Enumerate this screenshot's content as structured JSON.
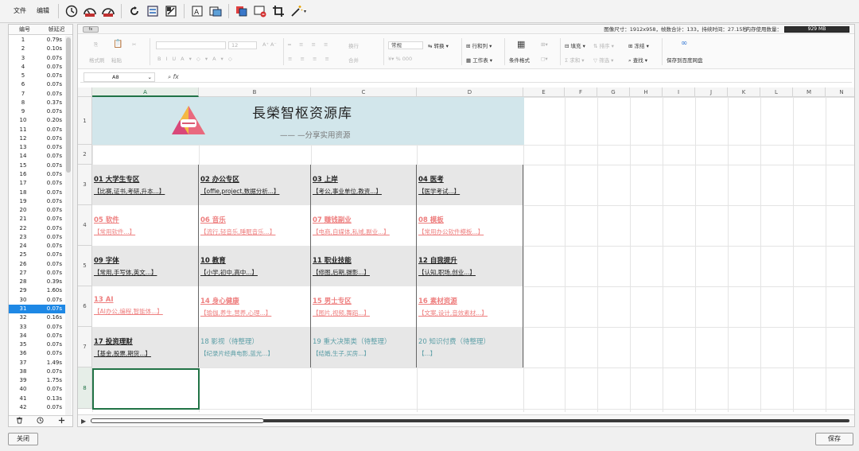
{
  "menu": {
    "file": "文件",
    "edit": "编辑"
  },
  "info": {
    "summary": "图像尺寸：1912x958，帧数合计：133，持续时间：27.15秒",
    "memory_label": "内存使用数量：",
    "memory_value": "929 MB",
    "fx_badge": "fx"
  },
  "frames": {
    "col_index": "编号",
    "col_delay": "帧延迟",
    "selected_index": 30,
    "items": [
      {
        "n": "1",
        "d": "0.79s"
      },
      {
        "n": "2",
        "d": "0.10s"
      },
      {
        "n": "3",
        "d": "0.07s"
      },
      {
        "n": "4",
        "d": "0.07s"
      },
      {
        "n": "5",
        "d": "0.07s"
      },
      {
        "n": "6",
        "d": "0.07s"
      },
      {
        "n": "7",
        "d": "0.07s"
      },
      {
        "n": "8",
        "d": "0.37s"
      },
      {
        "n": "9",
        "d": "0.07s"
      },
      {
        "n": "10",
        "d": "0.20s"
      },
      {
        "n": "11",
        "d": "0.07s"
      },
      {
        "n": "12",
        "d": "0.07s"
      },
      {
        "n": "13",
        "d": "0.07s"
      },
      {
        "n": "14",
        "d": "0.07s"
      },
      {
        "n": "15",
        "d": "0.07s"
      },
      {
        "n": "16",
        "d": "0.07s"
      },
      {
        "n": "17",
        "d": "0.07s"
      },
      {
        "n": "18",
        "d": "0.07s"
      },
      {
        "n": "19",
        "d": "0.07s"
      },
      {
        "n": "20",
        "d": "0.07s"
      },
      {
        "n": "21",
        "d": "0.07s"
      },
      {
        "n": "22",
        "d": "0.07s"
      },
      {
        "n": "23",
        "d": "0.07s"
      },
      {
        "n": "24",
        "d": "0.07s"
      },
      {
        "n": "25",
        "d": "0.07s"
      },
      {
        "n": "26",
        "d": "0.07s"
      },
      {
        "n": "27",
        "d": "0.07s"
      },
      {
        "n": "28",
        "d": "0.39s"
      },
      {
        "n": "29",
        "d": "1.60s"
      },
      {
        "n": "30",
        "d": "0.07s"
      },
      {
        "n": "31",
        "d": "0.07s"
      },
      {
        "n": "32",
        "d": "0.16s"
      },
      {
        "n": "33",
        "d": "0.07s"
      },
      {
        "n": "34",
        "d": "0.07s"
      },
      {
        "n": "35",
        "d": "0.07s"
      },
      {
        "n": "36",
        "d": "0.07s"
      },
      {
        "n": "37",
        "d": "1.49s"
      },
      {
        "n": "38",
        "d": "0.07s"
      },
      {
        "n": "39",
        "d": "1.75s"
      },
      {
        "n": "40",
        "d": "0.07s"
      },
      {
        "n": "41",
        "d": "0.13s"
      },
      {
        "n": "42",
        "d": "0.07s"
      }
    ]
  },
  "ribbon": {
    "paste": "粘贴",
    "format_painter": "格式刷",
    "font_size": "12",
    "wrap": "换行",
    "merge": "合并",
    "number_format": "常规",
    "convert": "转换",
    "rows_cols": "行和列",
    "worksheet": "工作表",
    "conditional": "条件格式",
    "fill": "填充",
    "sort": "排序",
    "freeze": "冻结",
    "sum": "求和",
    "filter": "筛选",
    "find": "查找",
    "save_cloud": "保存到百度网盘"
  },
  "formula": {
    "cell_ref": "A8",
    "fx": "fx"
  },
  "sheet": {
    "columns": [
      "A",
      "B",
      "C",
      "D",
      "E",
      "F",
      "G",
      "H",
      "I",
      "J",
      "K",
      "L",
      "M",
      "N"
    ],
    "rows": [
      "1",
      "2",
      "3",
      "4",
      "5",
      "6",
      "7",
      "8"
    ],
    "title": "長榮智枢资源库",
    "subtitle": "—— —分享实用资源",
    "categories": [
      {
        "t": "01 大学生专区",
        "s": "【比赛,证书,考研,升本...】"
      },
      {
        "t": "02 办公专区",
        "s": "【offie,project,数据分析...】"
      },
      {
        "t": "03 上岸",
        "s": "【考公,事业单位,教资...】"
      },
      {
        "t": "04 医考",
        "s": "【医学考试...】"
      },
      {
        "t": "05 软件",
        "s": "【常用软件...】"
      },
      {
        "t": "06 音乐",
        "s": "【流行,轻音乐,睡眠音乐...】"
      },
      {
        "t": "07 赚钱副业",
        "s": "【电商,自媒体,私域,副业...】"
      },
      {
        "t": "08 模板",
        "s": "【常用办公软件模板...】"
      },
      {
        "t": "09 字体",
        "s": "【常用,手写体,英文...】"
      },
      {
        "t": "10 教育",
        "s": "【小学,初中,高中...】"
      },
      {
        "t": "11 职业技能",
        "s": "【修图,后期,摄影...】"
      },
      {
        "t": "12 自我提升",
        "s": "【认知,职场,创业...】"
      },
      {
        "t": "13  AI",
        "s": "【AI办公,编程,智能体...】"
      },
      {
        "t": "14 身心健康",
        "s": "【瑜伽,养生,营养,心理...】"
      },
      {
        "t": "15 男士专区",
        "s": "【图片,视频,舞蹈...】"
      },
      {
        "t": "16 素材资源",
        "s": "【文案,设计,音效素材...】"
      },
      {
        "t": "17 投资理财",
        "s": "【基金,股票,期货...】"
      },
      {
        "t": "18 影视（待整理）",
        "s": "【纪录片经典电影,蓝光...】"
      },
      {
        "t": "19 重大决策类（待整理）",
        "s": "【结婚,生子,买房...】"
      },
      {
        "t": "20 知识付费（待整理）",
        "s": "【...】"
      }
    ]
  },
  "buttons": {
    "close": "关闭",
    "save": "保存"
  }
}
